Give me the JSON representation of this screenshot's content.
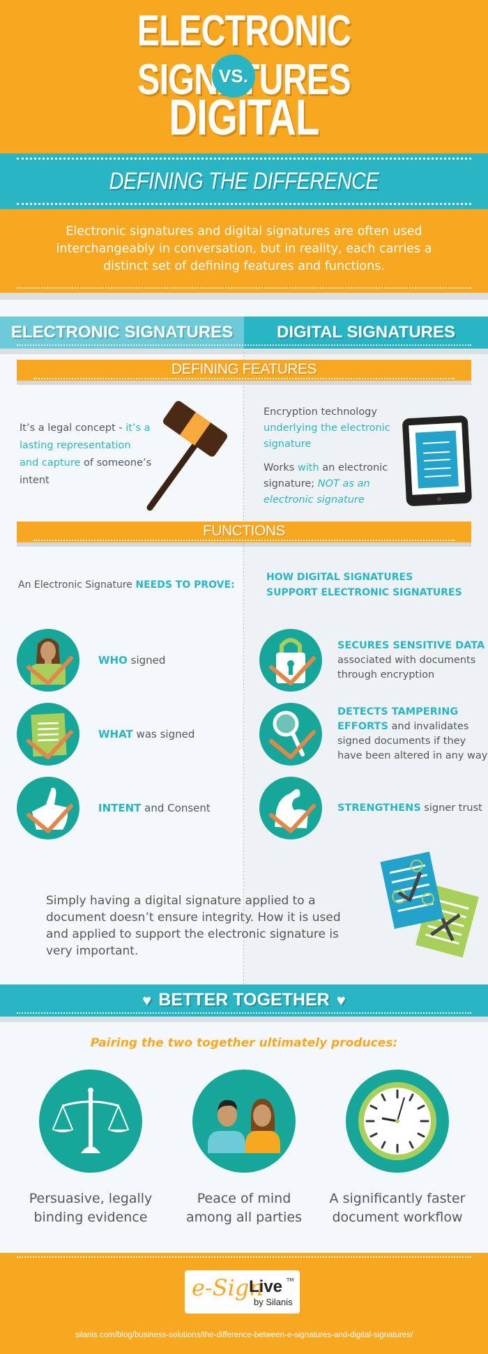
{
  "header": {
    "title_line1": "ELECTRONIC SIGNATURES",
    "vs": "VS.",
    "title_line2": "DIGITAL SIGNATURES",
    "subtitle": "DEFINING THE DIFFERENCE",
    "intro": "Electronic signatures and digital signatures are often used interchangeably in conversation, but in reality, each carries a distinct set of defining features and functions."
  },
  "columns": {
    "left": "ELECTRONIC SIGNATURES",
    "right": "DIGITAL SIGNATURES"
  },
  "defining_features": {
    "title": "DEFINING FEATURES",
    "electronic": {
      "part1": "It’s a legal concept - ",
      "part2": "it’s a lasting representation and capture",
      "part3": " of someone’s intent",
      "icon": "gavel-icon"
    },
    "digital": {
      "p1_a": "Encryption technology ",
      "p1_b": "underlying the electronic signature",
      "p2_a": "Works ",
      "p2_b": "with",
      "p2_c": " an electronic signature; ",
      "p2_d": "NOT as an electronic signature",
      "icon": "tablet-icon"
    }
  },
  "functions": {
    "title": "FUNCTIONS",
    "left_intro_a": "An Electronic Signature ",
    "left_intro_b": "NEEDS TO PROVE:",
    "right_intro_line1": "HOW DIGITAL SIGNATURES",
    "right_intro_line2": "SUPPORT ELECTRONIC SIGNATURES",
    "electronic_items": [
      {
        "bold": "WHO",
        "rest": " signed",
        "icon": "person-check-icon"
      },
      {
        "bold": "WHAT",
        "rest": " was signed",
        "icon": "document-check-icon"
      },
      {
        "bold": "INTENT",
        "rest": " and Consent",
        "icon": "thumbs-up-check-icon"
      }
    ],
    "digital_items": [
      {
        "bold": "SECURES SENSITIVE DATA",
        "rest": " associated with documents through encryption",
        "icon": "padlock-check-icon"
      },
      {
        "bold": "DETECTS TAMPERING EFFORTS",
        "rest": " and invalidates signed documents if they have been altered in any way",
        "icon": "magnifier-check-icon"
      },
      {
        "bold": "STRENGTHENS",
        "rest": " signer trust",
        "icon": "flexed-arm-check-icon"
      }
    ],
    "note": "Simply having a digital signature applied to a document doesn’t ensure integrity. How it is used and applied to support the electronic signature is very important."
  },
  "better_together": {
    "title": "BETTER TOGETHER",
    "subtitle": "Pairing the two together ultimately produces:",
    "benefits": [
      {
        "label": "Persuasive, legally binding evidence",
        "icon": "scales-of-justice-icon"
      },
      {
        "label": "Peace of mind among all parties",
        "icon": "two-people-icon"
      },
      {
        "label": "A significantly faster document workflow",
        "icon": "clock-icon"
      }
    ]
  },
  "footer": {
    "logo_main_a": "e-Sign",
    "logo_main_b": "Live",
    "logo_tm": "TM",
    "logo_by": "by Silanis",
    "url": "silanis.com/blog/business-solutions/the-difference-between-e-signatures-and-digital-signatures/"
  },
  "colors": {
    "orange": "#f7a720",
    "teal": "#2ab5c5",
    "light_teal": "#6ccbd7",
    "circle_green": "#16a79a",
    "check_orange": "#e0884a",
    "text_gray": "#555555"
  }
}
